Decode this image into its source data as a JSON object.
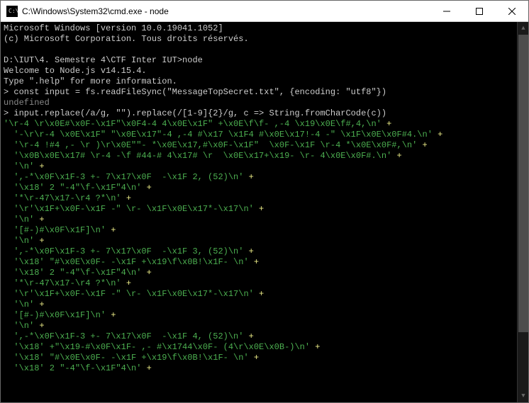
{
  "window": {
    "title": "C:\\Windows\\System32\\cmd.exe - node"
  },
  "terminal": {
    "lines": [
      {
        "cls": "c-white",
        "text": "Microsoft Windows [version 10.0.19041.1052]"
      },
      {
        "cls": "c-white",
        "text": "(c) Microsoft Corporation. Tous droits réservés."
      },
      {
        "cls": "c-white",
        "text": ""
      },
      {
        "cls": "c-white",
        "text": "D:\\IUT\\4. Semestre 4\\CTF Inter IUT>node"
      },
      {
        "cls": "c-white",
        "text": "Welcome to Node.js v14.15.4."
      },
      {
        "cls": "c-white",
        "text": "Type \".help\" for more information."
      },
      {
        "cls": "c-white",
        "text": "> const input = fs.readFileSync(\"MessageTopSecret.txt\", {encoding: \"utf8\"})"
      },
      {
        "cls": "c-gray",
        "text": "undefined"
      },
      {
        "cls": "c-white",
        "text": "> input.replace(/a/g, \"\").replace(/[1-9]{2}/g, c => String.fromCharCode(c))"
      },
      {
        "segments": [
          {
            "cls": "c-green",
            "text": "'\\r-4 \\r\\x0E#\\x0F-\\x1F\"\\x0F4-4 4\\x0E\\x1F\" +\\x0E\\f\\f- ,-4 \\x19\\x0E\\f#,4,\\n'"
          },
          {
            "cls": "c-yellow",
            "text": " +"
          }
        ]
      },
      {
        "segments": [
          {
            "cls": "c-green",
            "text": "  '-\\r\\r-4 \\x0E\\x1F\" \"\\x0E\\x17\"-4 ,-4 #\\x17 \\x1F4 #\\x0E\\x17!-4 -\" \\x1F\\x0E\\x0F#4.\\n'"
          },
          {
            "cls": "c-yellow",
            "text": " +"
          }
        ]
      },
      {
        "segments": [
          {
            "cls": "c-green",
            "text": "  '\\r-4 !#4 ,- \\r )\\r\\x0E\"\"- *\\x0E\\x17,#\\x0F-\\x1F\"  \\x0F-\\x1F \\r-4 *\\x0E\\x0F#,\\n'"
          },
          {
            "cls": "c-yellow",
            "text": " +"
          }
        ]
      },
      {
        "segments": [
          {
            "cls": "c-green",
            "text": "  '\\x0B\\x0E\\x17# \\r-4 -\\f #44-# 4\\x17# \\r  \\x0E\\x17+\\x19- \\r- 4\\x0E\\x0F#.\\n'"
          },
          {
            "cls": "c-yellow",
            "text": " +"
          }
        ]
      },
      {
        "segments": [
          {
            "cls": "c-green",
            "text": "  '\\n'"
          },
          {
            "cls": "c-yellow",
            "text": " +"
          }
        ]
      },
      {
        "segments": [
          {
            "cls": "c-green",
            "text": "  ',-*\\x0F\\x1F-3 +- 7\\x17\\x0F  -\\x1F 2, (52)\\n'"
          },
          {
            "cls": "c-yellow",
            "text": " +"
          }
        ]
      },
      {
        "segments": [
          {
            "cls": "c-green",
            "text": "  '\\x18' 2 \"-4\"\\f-\\x1F\"4\\n'"
          },
          {
            "cls": "c-yellow",
            "text": " +"
          }
        ]
      },
      {
        "segments": [
          {
            "cls": "c-green",
            "text": "  '*\\r-47\\x17-\\r4 ?*\\n'"
          },
          {
            "cls": "c-yellow",
            "text": " +"
          }
        ]
      },
      {
        "segments": [
          {
            "cls": "c-green",
            "text": "  '\\r'\\x1F+\\x0F-\\x1F -\" \\r- \\x1F\\x0E\\x17*-\\x17\\n'"
          },
          {
            "cls": "c-yellow",
            "text": " +"
          }
        ]
      },
      {
        "segments": [
          {
            "cls": "c-green",
            "text": "  '\\n'"
          },
          {
            "cls": "c-yellow",
            "text": " +"
          }
        ]
      },
      {
        "segments": [
          {
            "cls": "c-green",
            "text": "  '[#-)#\\x0F\\x1F]\\n'"
          },
          {
            "cls": "c-yellow",
            "text": " +"
          }
        ]
      },
      {
        "segments": [
          {
            "cls": "c-green",
            "text": "  '\\n'"
          },
          {
            "cls": "c-yellow",
            "text": " +"
          }
        ]
      },
      {
        "segments": [
          {
            "cls": "c-green",
            "text": "  ',-*\\x0F\\x1F-3 +- 7\\x17\\x0F  -\\x1F 3, (52)\\n'"
          },
          {
            "cls": "c-yellow",
            "text": " +"
          }
        ]
      },
      {
        "segments": [
          {
            "cls": "c-green",
            "text": "  '\\x18' \"#\\x0E\\x0F- -\\x1F +\\x19\\f\\x0B!\\x1F- \\n'"
          },
          {
            "cls": "c-yellow",
            "text": " +"
          }
        ]
      },
      {
        "segments": [
          {
            "cls": "c-green",
            "text": "  '\\x18' 2 \"-4\"\\f-\\x1F\"4\\n'"
          },
          {
            "cls": "c-yellow",
            "text": " +"
          }
        ]
      },
      {
        "segments": [
          {
            "cls": "c-green",
            "text": "  '*\\r-47\\x17-\\r4 ?*\\n'"
          },
          {
            "cls": "c-yellow",
            "text": " +"
          }
        ]
      },
      {
        "segments": [
          {
            "cls": "c-green",
            "text": "  '\\r'\\x1F+\\x0F-\\x1F -\" \\r- \\x1F\\x0E\\x17*-\\x17\\n'"
          },
          {
            "cls": "c-yellow",
            "text": " +"
          }
        ]
      },
      {
        "segments": [
          {
            "cls": "c-green",
            "text": "  '\\n'"
          },
          {
            "cls": "c-yellow",
            "text": " +"
          }
        ]
      },
      {
        "segments": [
          {
            "cls": "c-green",
            "text": "  '[#-)#\\x0F\\x1F]\\n'"
          },
          {
            "cls": "c-yellow",
            "text": " +"
          }
        ]
      },
      {
        "segments": [
          {
            "cls": "c-green",
            "text": "  '\\n'"
          },
          {
            "cls": "c-yellow",
            "text": " +"
          }
        ]
      },
      {
        "segments": [
          {
            "cls": "c-green",
            "text": "  ',-*\\x0F\\x1F-3 +- 7\\x17\\x0F  -\\x1F 4, (52)\\n'"
          },
          {
            "cls": "c-yellow",
            "text": " +"
          }
        ]
      },
      {
        "segments": [
          {
            "cls": "c-green",
            "text": "  '\\x18' +\"\\x19-#\\x0F\\x1F- ,- #\\x1744\\x0F- (4\\r\\x0E\\x0B-)\\n'"
          },
          {
            "cls": "c-yellow",
            "text": " +"
          }
        ]
      },
      {
        "segments": [
          {
            "cls": "c-green",
            "text": "  '\\x18' \"#\\x0E\\x0F- -\\x1F +\\x19\\f\\x0B!\\x1F- \\n'"
          },
          {
            "cls": "c-yellow",
            "text": " +"
          }
        ]
      },
      {
        "segments": [
          {
            "cls": "c-green",
            "text": "  '\\x18' 2 \"-4\"\\f-\\x1F\"4\\n'"
          },
          {
            "cls": "c-yellow",
            "text": " +"
          }
        ]
      }
    ]
  }
}
